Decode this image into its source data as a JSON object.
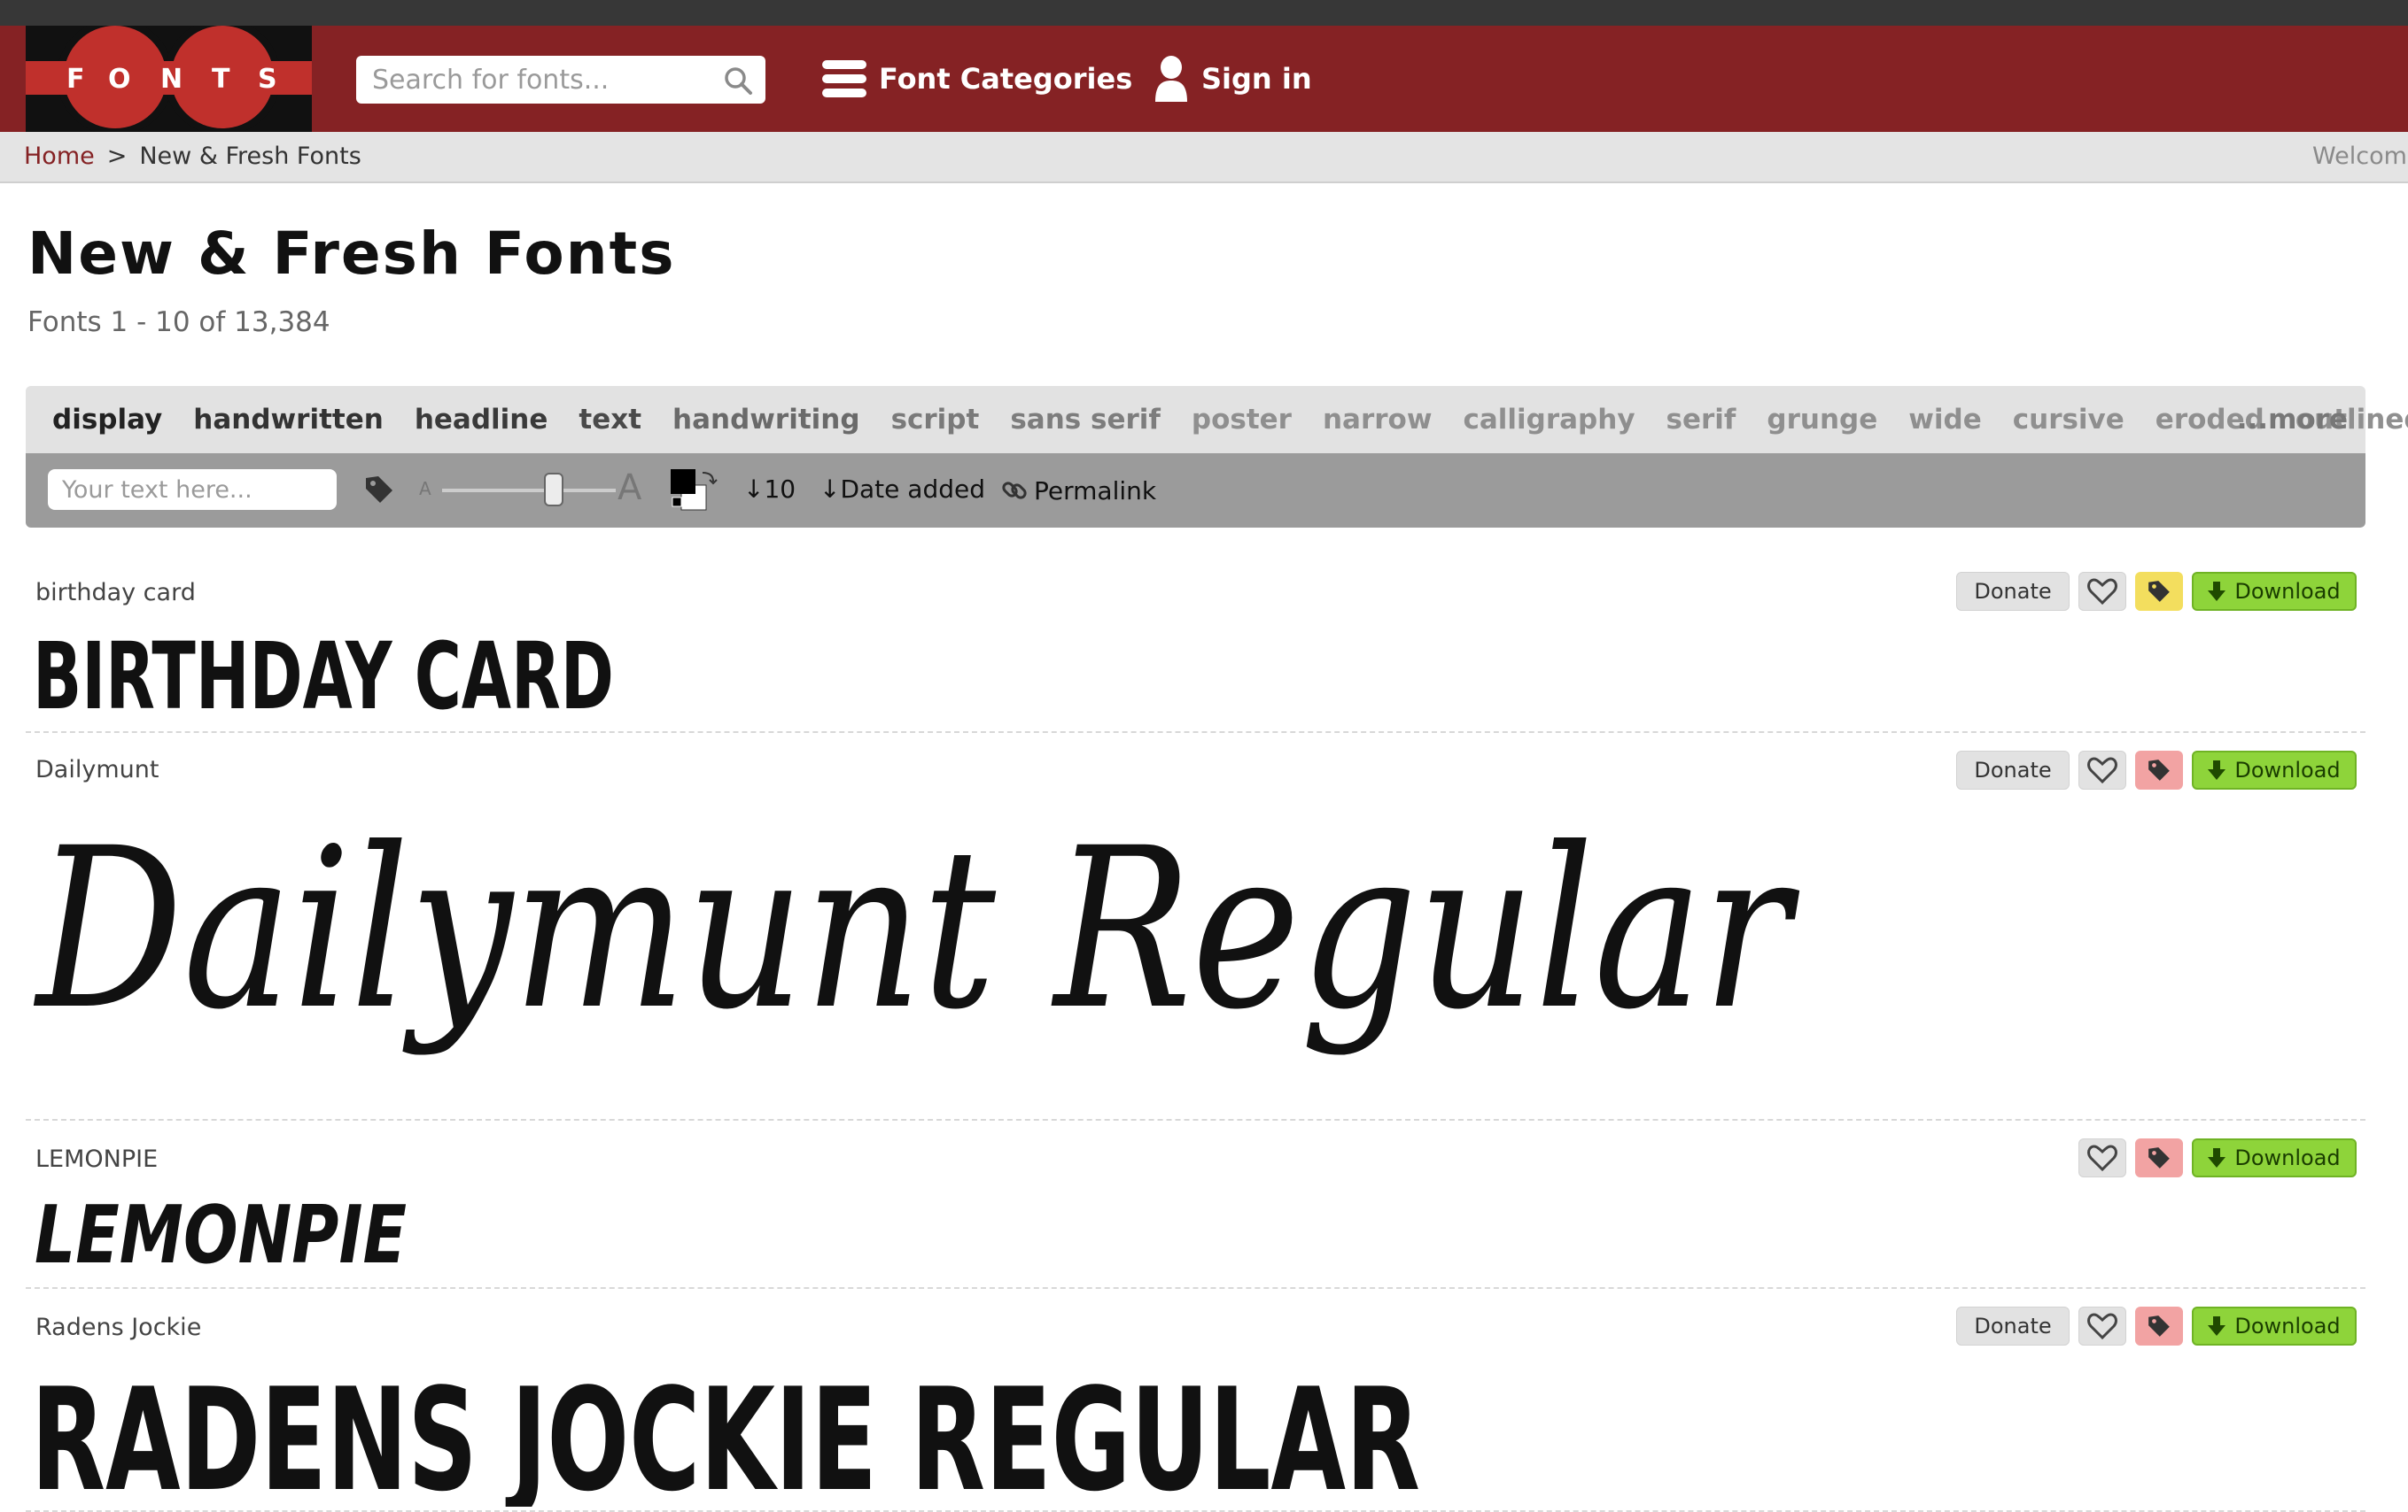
{
  "brand": {
    "logo_letters": [
      "F",
      "O",
      "N",
      "T",
      "S"
    ]
  },
  "header": {
    "search_placeholder": "Search for fonts...",
    "font_categories_label": "Font Categories",
    "sign_in_label": "Sign in"
  },
  "breadcrumb": {
    "home": "Home",
    "separator": ">",
    "current": "New & Fresh Fonts",
    "welcome": "Welcome"
  },
  "page": {
    "title": "New & Fresh Fonts",
    "count_text": "Fonts 1 - 10 of 13,384"
  },
  "tags": [
    {
      "label": "display",
      "color": "#222222"
    },
    {
      "label": "handwritten",
      "color": "#333333"
    },
    {
      "label": "headline",
      "color": "#3a3a3a"
    },
    {
      "label": "text",
      "color": "#4a4a4a"
    },
    {
      "label": "handwriting",
      "color": "#6a6a6a"
    },
    {
      "label": "script",
      "color": "#7a7a7a"
    },
    {
      "label": "sans serif",
      "color": "#7d7d7d"
    },
    {
      "label": "poster",
      "color": "#8f8f8f"
    },
    {
      "label": "narrow",
      "color": "#8f8f8f"
    },
    {
      "label": "calligraphy",
      "color": "#8f8f8f"
    },
    {
      "label": "serif",
      "color": "#8f8f8f"
    },
    {
      "label": "grunge",
      "color": "#8f8f8f"
    },
    {
      "label": "wide",
      "color": "#8f8f8f"
    },
    {
      "label": "cursive",
      "color": "#8f8f8f"
    },
    {
      "label": "eroded",
      "color": "#8f8f8f"
    },
    {
      "label": "outlined",
      "color": "#8f8f8f"
    }
  ],
  "tags_more": "...more",
  "toolbar": {
    "text_placeholder": "Your text here...",
    "size_small": "A",
    "size_large": "A",
    "per_page": "↓10",
    "sort": "↓Date added",
    "permalink": "Permalink"
  },
  "fonts": [
    {
      "name": "birthday card",
      "preview": "BIRTHDAY CARD",
      "donate": "Donate",
      "download": "Download",
      "tag_state": "yellow"
    },
    {
      "name": "Dailymunt",
      "preview": "Dailymunt Regular",
      "donate": "Donate",
      "download": "Download",
      "tag_state": "pink"
    },
    {
      "name": "LEMONPIE",
      "preview": "LEMONPIE",
      "download": "Download",
      "tag_state": "pink"
    },
    {
      "name": "Radens Jockie",
      "preview": "RADENS JOCKIE REGULAR",
      "donate": "Donate",
      "download": "Download",
      "tag_state": "pink"
    }
  ],
  "colors": {
    "header_bg": "#852224",
    "topstrip": "#373737",
    "download_green": "#8ed43a",
    "tag_yellow": "#f3de5e",
    "tag_pink": "#f2a3a3"
  }
}
